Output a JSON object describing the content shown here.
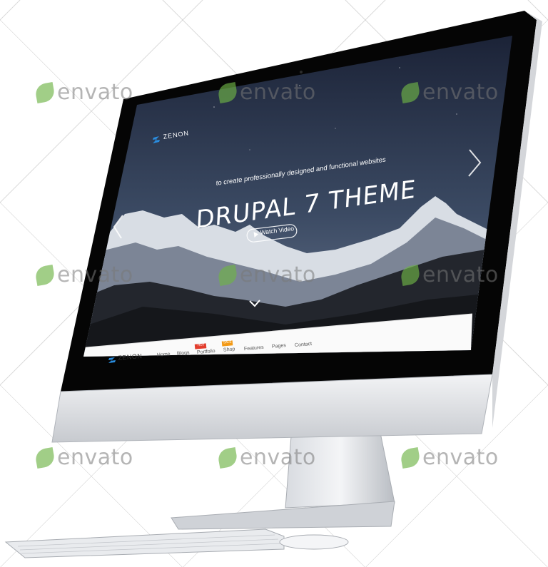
{
  "site": {
    "logo_top": "ZENON",
    "logo_nav": "ZENON",
    "tagline": "to create professionally designed and functional websites",
    "headline": "DRUPAL 7 THEME",
    "cta_label": "Watch Video"
  },
  "nav": {
    "items": [
      {
        "label": "Home",
        "badge": ""
      },
      {
        "label": "Blogs",
        "badge": ""
      },
      {
        "label": "Portfolio",
        "badge": "HOT"
      },
      {
        "label": "Shop",
        "badge": "SALE"
      },
      {
        "label": "Features",
        "badge": ""
      },
      {
        "label": "Pages",
        "badge": ""
      },
      {
        "label": "Contact",
        "badge": ""
      }
    ]
  },
  "watermark": {
    "text": "envato"
  },
  "colors": {
    "accent_logo": "#2a8ddf",
    "badge_hot": "#e23c2c",
    "badge_sale": "#f39a16",
    "sky_top": "#1b2236",
    "sky_bottom": "#5b6b82"
  },
  "icons": [
    "chevron-left-icon",
    "chevron-right-icon",
    "chevron-down-icon",
    "play-icon",
    "zenon-logo-icon"
  ]
}
